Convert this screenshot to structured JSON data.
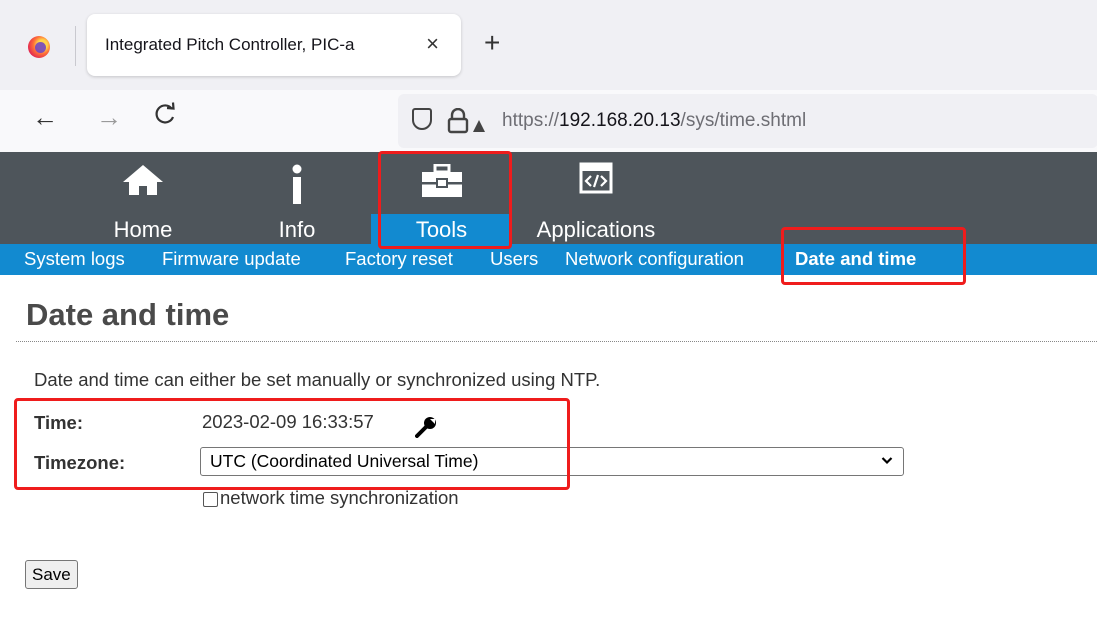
{
  "browser": {
    "tab_title": "Integrated Pitch Controller, PIC-a",
    "tab_close": "×",
    "new_tab": "+",
    "url_scheme": "https://",
    "url_host": "192.168.20.13",
    "url_path": "/sys/time.shtml",
    "back": "←",
    "forward": "→",
    "reload": "C"
  },
  "topnav": {
    "items": [
      {
        "label": "Home",
        "icon": "home-icon"
      },
      {
        "label": "Info",
        "icon": "info-icon"
      },
      {
        "label": "Tools",
        "icon": "toolbox-icon",
        "active": true
      },
      {
        "label": "Applications",
        "icon": "code-window-icon"
      }
    ]
  },
  "subnav": {
    "items": [
      {
        "label": "System logs"
      },
      {
        "label": "Firmware update"
      },
      {
        "label": "Factory reset"
      },
      {
        "label": "Users"
      },
      {
        "label": "Network configuration"
      },
      {
        "label": "Date and time",
        "active": true
      }
    ]
  },
  "main": {
    "title": "Date and time",
    "description": "Date and time can either be set manually or synchronized using NTP.",
    "time_label": "Time:",
    "time_value": "2023-02-09 16:33:57",
    "timezone_label": "Timezone:",
    "timezone_value": "UTC (Coordinated Universal Time)",
    "ntp_checked": false,
    "ntp_label": "network time synchronization",
    "save_label": "Save"
  },
  "colors": {
    "nav_bg": "#4e555b",
    "accent_blue": "#128ad0",
    "highlight_red": "#ef1c1c"
  }
}
